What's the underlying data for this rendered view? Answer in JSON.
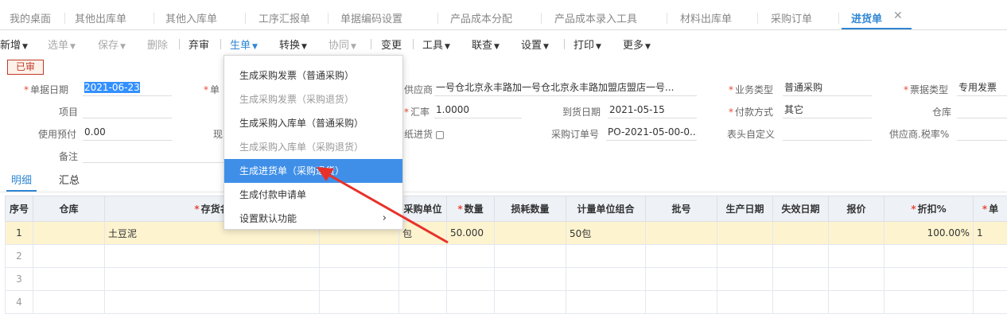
{
  "tabs": [
    "我的桌面",
    "其他出库单",
    "其他入库单",
    "工序汇报单",
    "单据编码设置",
    "产品成本分配",
    "产品成本录入工具",
    "材料出库单",
    "采购订单",
    "进货单"
  ],
  "toolbar": {
    "new": "新增",
    "select": "选单",
    "save": "保存",
    "delete": "删除",
    "abandon": "弃审",
    "generate": "生单",
    "convert": "转换",
    "collaborate": "协同",
    "change": "变更",
    "tools": "工具",
    "link": "联查",
    "settings": "设置",
    "print": "打印",
    "more": "更多"
  },
  "status_badge": "已审",
  "form": {
    "doc_date_label": "单据日期",
    "doc_date": "2021-06-23",
    "doc_no_label": "单",
    "supplier_label": "供应商",
    "supplier": "一号仓北京永丰路加一号仓北京永丰路加盟店盟店一号...",
    "biz_type_label": "业务类型",
    "biz_type": "普通采购",
    "invoice_type_label": "票据类型",
    "invoice_type": "专用发票",
    "project_label": "项目",
    "rate_label": "汇率",
    "rate": "1.0000",
    "arrival_label": "到货日期",
    "arrival": "2021-05-15",
    "pay_label": "付款方式",
    "pay": "其它",
    "warehouse_label": "仓库",
    "prepay_label": "使用预付",
    "prepay": "0.00",
    "cash_label": "现",
    "paper_label": "纸进货",
    "po_label": "采购订单号",
    "po": "PO-2021-05-00-0...",
    "custom_label": "表头自定义",
    "tax_label": "供应商.税率%",
    "note_label": "备注"
  },
  "subtabs": [
    "明细",
    "汇总"
  ],
  "grid": {
    "headers": [
      "序号",
      "仓库",
      "存货名",
      "",
      "采购单位",
      "数量",
      "损耗数量",
      "计量单位组合",
      "批号",
      "生产日期",
      "失效日期",
      "报价",
      "折扣%",
      "单"
    ],
    "rows": [
      [
        "1",
        "",
        "土豆泥",
        "",
        "包",
        "50.000",
        "",
        "50包",
        "",
        "",
        "",
        "",
        "100.00%",
        "1"
      ],
      [
        "2"
      ],
      [
        "3"
      ],
      [
        "4"
      ]
    ]
  },
  "menu": [
    "生成采购发票（普通采购）",
    "生成采购发票（采购退货）",
    "生成采购入库单（普通采购）",
    "生成采购入库单（采购退货）",
    "生成进货单（采购退货）",
    "生成付款申请单",
    "设置默认功能"
  ],
  "colors": {
    "accent": "#2f86d4",
    "highlight": "#3f8fe8",
    "arrow": "#e8312a",
    "row_selected": "#fdf3cf"
  }
}
